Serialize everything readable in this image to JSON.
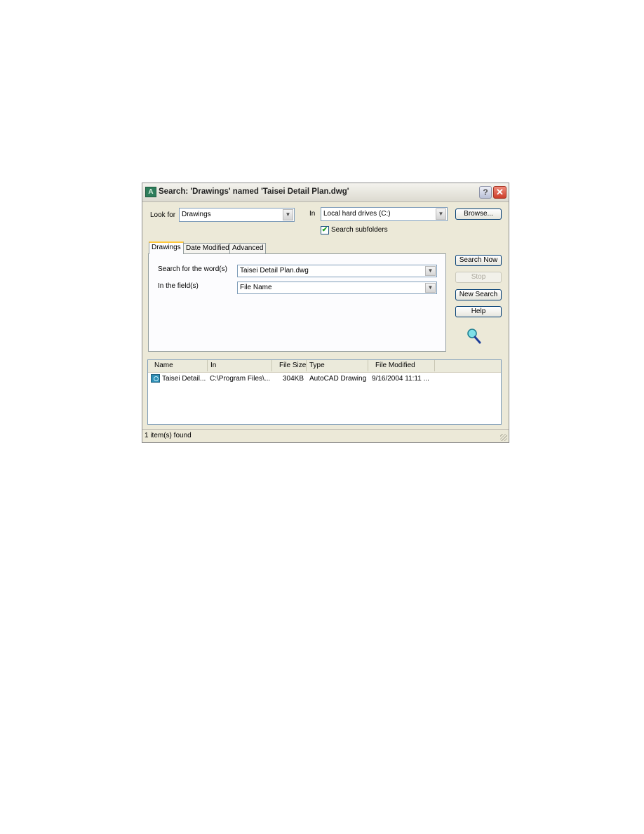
{
  "dialog": {
    "title": "Search: 'Drawings' named 'Taisei Detail Plan.dwg'",
    "app_icon": "autocad-icon",
    "title_buttons": {
      "help": "?",
      "close": "✕"
    }
  },
  "lookfor": {
    "label": "Look for",
    "value": "Drawings"
  },
  "in": {
    "label": "In",
    "value": "Local hard drives (C:)"
  },
  "browse_label": "Browse...",
  "search_subfolders": {
    "label": "Search subfolders",
    "checked": true,
    "check_glyph": "✔"
  },
  "tabs": [
    {
      "label": "Drawings",
      "active": true
    },
    {
      "label": "Date Modified",
      "active": false
    },
    {
      "label": "Advanced",
      "active": false
    }
  ],
  "drawings_tab": {
    "words_label": "Search for the word(s)",
    "words_value": "Taisei Detail Plan.dwg",
    "field_label": "In the field(s)",
    "field_value": "File Name"
  },
  "buttons": {
    "search_now": "Search Now",
    "stop": "Stop",
    "new_search": "New Search",
    "help": "Help"
  },
  "results": {
    "columns": [
      "Name",
      "In",
      "File Size",
      "Type",
      "File Modified"
    ],
    "rows": [
      {
        "name": "Taisei Detail...",
        "in": "C:\\Program Files\\...",
        "size": "304KB",
        "type": "AutoCAD Drawing",
        "modified": "9/16/2004 11:11 ..."
      }
    ]
  },
  "status": "1 item(s) found",
  "arrow_glyph": "▼"
}
